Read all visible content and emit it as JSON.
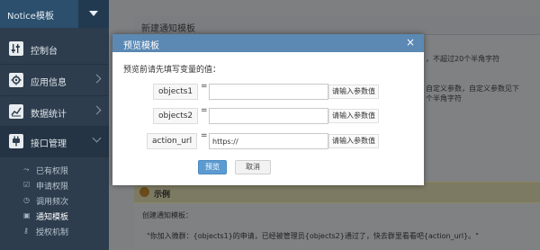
{
  "sidebar": {
    "app_title": "Notice模板",
    "items": [
      {
        "label": "控制台",
        "icon": "sliders-icon"
      },
      {
        "label": "应用信息",
        "icon": "gear-icon"
      },
      {
        "label": "数据统计",
        "icon": "chart-icon"
      },
      {
        "label": "接口管理",
        "icon": "plug-icon"
      }
    ],
    "subitems": [
      {
        "label": "已有权限",
        "icon": "link-icon"
      },
      {
        "label": "申请权限",
        "icon": "checkbox-icon"
      },
      {
        "label": "调用频次",
        "icon": "clock-icon"
      },
      {
        "label": "通知模板",
        "icon": "message-icon"
      },
      {
        "label": "授权机制",
        "icon": "key-icon"
      }
    ]
  },
  "main": {
    "panel_title": "新建通知模板",
    "bg_hint_1": "，不超过20个半角字符",
    "bg_hint_2": "自定义参数，自定义参数见下",
    "bg_hint_3": "个半角字符",
    "example_label": "示例",
    "create_label": "创建通知模板：",
    "example_text": "\"你加入微群：{objects1}的申请，已经被管理员{objects2}通过了，快去群里看看吧{action_url}。\""
  },
  "modal": {
    "title": "预览模板",
    "close": "×",
    "hint": "预览前请先填写变量的值：",
    "equals": "=",
    "fields": [
      {
        "label": "objects1",
        "value": "",
        "hint": "请输入参数值"
      },
      {
        "label": "objects2",
        "value": "",
        "hint": "请输入参数值"
      },
      {
        "label": "action_url",
        "value": "https://",
        "hint": "请输入参数值"
      }
    ],
    "preview_button": "预览",
    "cancel_button": "取消"
  }
}
